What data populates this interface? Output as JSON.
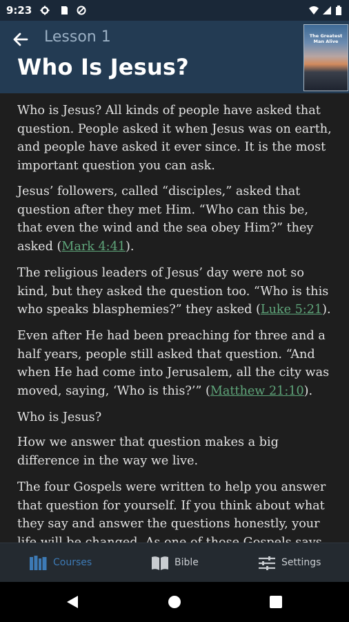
{
  "status_bar": {
    "time": "9:23"
  },
  "header": {
    "lesson_label": "Lesson 1",
    "title": "Who Is Jesus?",
    "book_cover_title": "The Greatest Man Alive"
  },
  "content": {
    "paragraphs": [
      {
        "text": "Who is Jesus? All kinds of people have asked that question. People asked it when Jesus was on earth, and people have asked it ever since. It is the most important question you can ask."
      },
      {
        "before": "Jesus’ followers, called “disciples,” asked that question after they met Him. “Who can this be, that even the wind and the sea obey Him?” they asked (",
        "link": "Mark 4:41",
        "after": ")."
      },
      {
        "before": "The religious leaders of Jesus’ day were not so kind, but they asked the question too. “Who is this who speaks blasphemies?” they asked (",
        "link": "Luke 5:21",
        "after": ")."
      },
      {
        "before": "Even after He had been preaching for three and a half years, people still asked that question. “And when He had come into Jerusalem, all the city was moved, saying, ‘Who is this?’” (",
        "link": "Matthew 21:10",
        "after": ")."
      },
      {
        "text": "Who is Jesus?"
      },
      {
        "text": "How we answer that question makes a big difference in the way we live."
      },
      {
        "text": "The four Gospels were written to help you answer that question for yourself. If you think about what they say and answer the questions honestly, your life will be changed. As one of those Gospels says,"
      }
    ]
  },
  "bottom_nav": {
    "courses": "Courses",
    "bible": "Bible",
    "settings": "Settings",
    "active": "courses",
    "active_color": "#3d7ab5",
    "inactive_color": "#c9cdd1"
  },
  "colors": {
    "header_bg": "#233b53",
    "content_bg": "#1e1e1e",
    "link": "#5fa57a"
  }
}
